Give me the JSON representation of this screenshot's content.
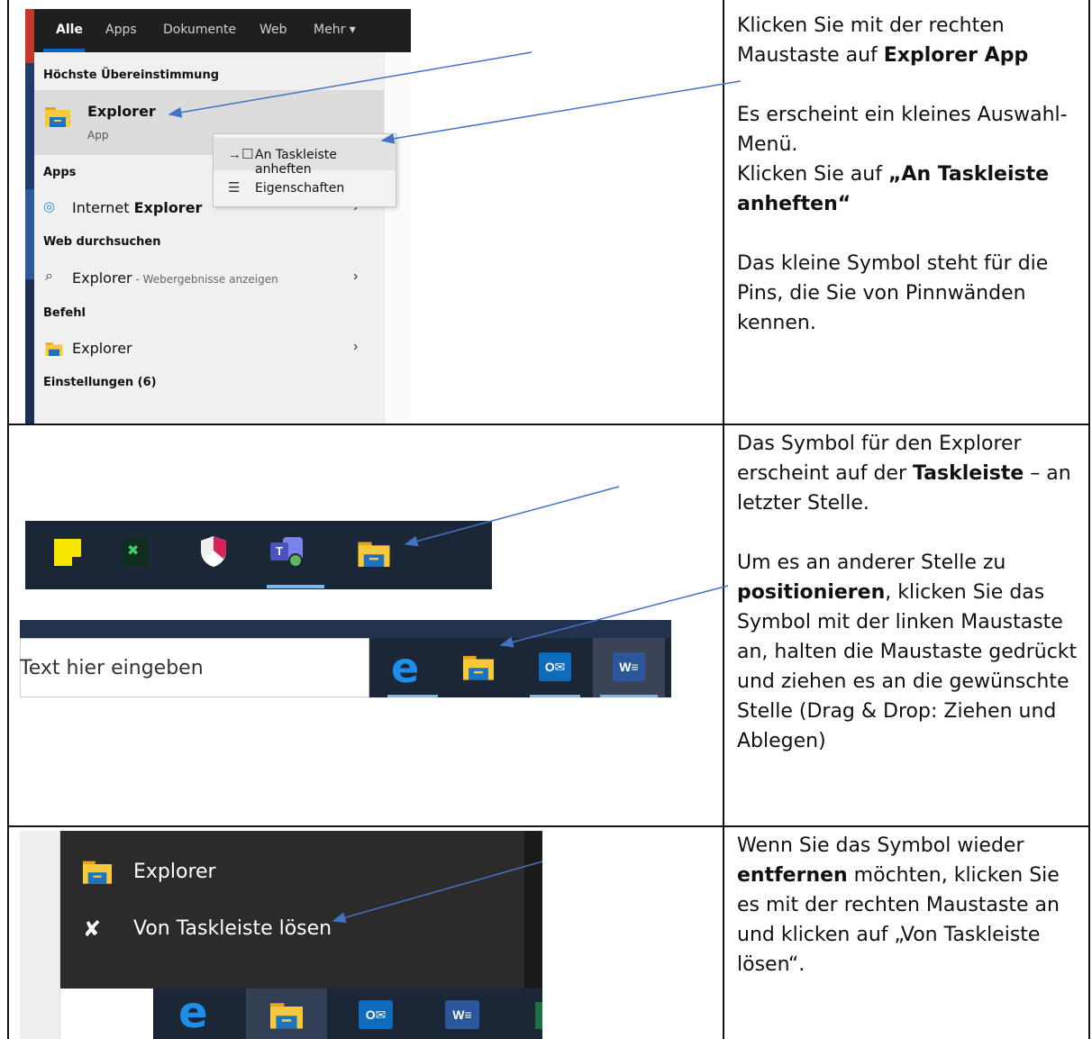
{
  "section1": {
    "tabs": [
      "Alle",
      "Apps",
      "Dokumente",
      "Web",
      "Mehr ▾"
    ],
    "best_match_heading": "Höchste Übereinstimmung",
    "best_match_title": "Explorer",
    "best_match_subtitle": "App",
    "apps_heading": "Apps",
    "ie_prefix": "Internet ",
    "ie_bold": "Explorer",
    "web_heading": "Web durchsuchen",
    "web_query": "Explorer",
    "web_hint": " - Webergebnisse anzeigen",
    "command_heading": "Befehl",
    "command_item": "Explorer",
    "settings_heading": "Einstellungen (6)",
    "context_menu": [
      "An Taskleiste anheften",
      "Eigenschaften"
    ],
    "desc_line1": "Klicken Sie mit der rechten Maustaste auf ",
    "desc_line1_bold": "Explorer App",
    "desc_line2": "Es erscheint ein kleines Auswahl-Menü.",
    "desc_line3": "Klicken Sie auf ",
    "desc_line3_bold": "„An Taskleiste anheften“",
    "desc_line4": "Das kleine Symbol steht für die Pins, die Sie von Pinnwänden kennen."
  },
  "section2": {
    "search_placeholder": "Text hier eingeben",
    "desc_p1_a": "Das Symbol für den Explorer erscheint auf der ",
    "desc_p1_bold": "Taskleiste",
    "desc_p1_b": " – an letzter Stelle.",
    "desc_p2_a": "Um es an anderer Stelle zu ",
    "desc_p2_bold": "positionieren",
    "desc_p2_b": ", klicken Sie das Symbol mit der linken Maustaste an, halten die Maustaste gedrückt  und ziehen es an die gewünschte Stelle (Drag & Drop: Ziehen und Ablegen)"
  },
  "section3": {
    "jump_item_1": "Explorer",
    "jump_item_2": "Von Taskleiste lösen",
    "desc_a": "Wenn Sie das Symbol wieder ",
    "desc_bold": "entfernen",
    "desc_b": " möchten, klicken Sie es mit der rechten Maustaste an und klicken auf „Von Taskleiste lösen“."
  },
  "colors": {
    "taskbar": "#1b2636",
    "accent": "#0a64c4",
    "arrow": "#4472c4"
  }
}
